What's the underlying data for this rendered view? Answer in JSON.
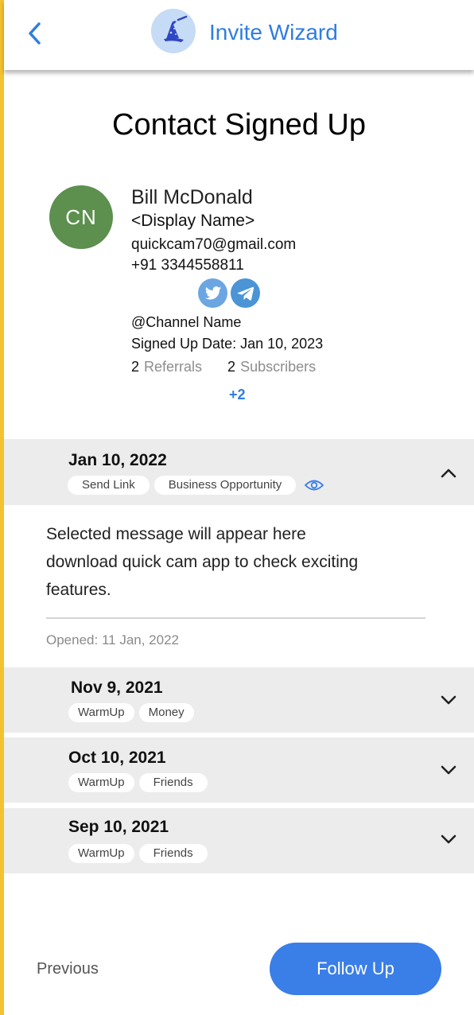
{
  "header": {
    "app_title": "Invite Wizard",
    "back_icon": "chevron-left-icon",
    "logo_icon": "wizard-hat-icon",
    "accent_color": "#2f7de1"
  },
  "page": {
    "title": "Contact Signed Up"
  },
  "contact": {
    "initials": "CN",
    "name": "Bill McDonald",
    "display_name": "<Display Name>",
    "email": "quickcam70@gmail.com",
    "phone": "+91 3344558811",
    "social_icons": [
      "twitter-icon",
      "telegram-icon"
    ],
    "channel": "@Channel Name",
    "signed_up": "Signed Up Date: Jan 10, 2023",
    "referrals_count": "2",
    "referrals_label": "Referrals",
    "subscribers_count": "2",
    "subscribers_label": "Subscribers",
    "more": "+2",
    "avatar_color": "#5d8f4f"
  },
  "messages": [
    {
      "date": "Jan 10, 2022",
      "tags": [
        "Send Link",
        "Business Opportunity"
      ],
      "expanded": true,
      "body_line1": "Selected message will appear here",
      "body_line2": "download quick cam app to check exciting",
      "body_line3": "features.",
      "opened": "Opened: 11 Jan, 2022"
    },
    {
      "date": "Nov 9, 2021",
      "tags": [
        "WarmUp",
        "Money"
      ],
      "expanded": false
    },
    {
      "date": "Oct 10, 2021",
      "tags": [
        "WarmUp",
        "Friends"
      ],
      "expanded": false
    },
    {
      "date": "Sep 10, 2021",
      "tags": [
        "WarmUp",
        "Friends"
      ],
      "expanded": false
    }
  ],
  "footer": {
    "previous_label": "Previous",
    "follow_up_label": "Follow Up",
    "button_color": "#3a7ee8"
  }
}
